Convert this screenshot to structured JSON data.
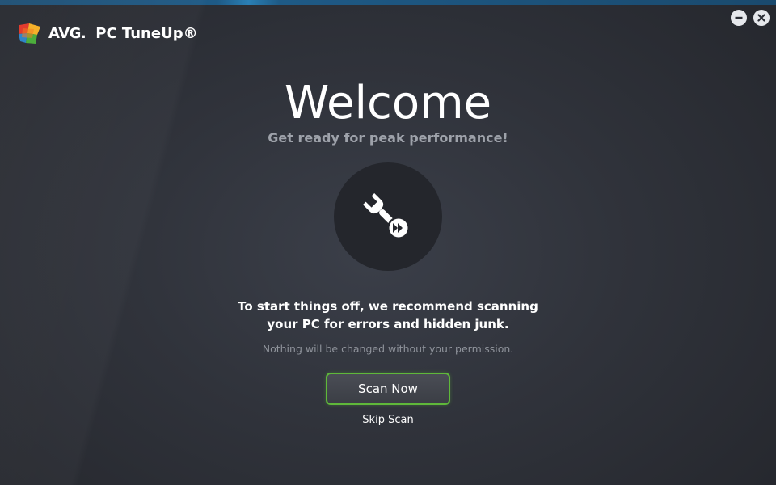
{
  "app": {
    "brand": "AVG.",
    "product": "PC TuneUp®"
  },
  "window_controls": {
    "minimize_icon": "minus-icon",
    "close_icon": "close-icon"
  },
  "welcome": {
    "title": "Welcome",
    "subtitle": "Get ready for peak performance!",
    "icon": "wrench-fast-forward-icon",
    "recommend_line1": "To start things off, we recommend scanning",
    "recommend_line2": "your PC for errors and hidden junk.",
    "permission_note": "Nothing will be changed without your permission.",
    "scan_button_label": "Scan Now",
    "skip_link_label": "Skip Scan"
  },
  "colors": {
    "accent_green": "#5fb83a",
    "top_bar_blue": "#1e5a86",
    "background": "#30333b"
  }
}
